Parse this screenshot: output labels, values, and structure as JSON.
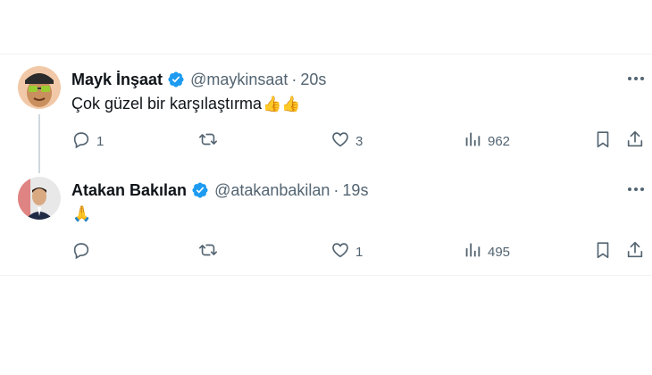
{
  "tweets": [
    {
      "name": "Mayk İnşaat",
      "handle": "@maykinsaat",
      "separator": "·",
      "time": "20s",
      "text": "Çok güzel bir karşılaştırma",
      "emoji": "👍👍",
      "replies": "1",
      "retweets": "",
      "likes": "3",
      "views": "962"
    },
    {
      "name": "Atakan Bakılan",
      "handle": "@atakanbakilan",
      "separator": "·",
      "time": "19s",
      "text": "",
      "emoji": "🙏",
      "replies": "",
      "retweets": "",
      "likes": "1",
      "views": "495"
    }
  ],
  "icons": {
    "verified": "verified-badge-icon",
    "more": "more-icon",
    "reply": "reply-icon",
    "retweet": "retweet-icon",
    "like": "heart-icon",
    "views": "views-icon",
    "bookmark": "bookmark-icon",
    "share": "share-icon"
  },
  "colors": {
    "verified_blue": "#1d9bf0",
    "secondary_text": "#536471",
    "divider": "#eff3f4",
    "thread_line": "#cfd9de"
  }
}
